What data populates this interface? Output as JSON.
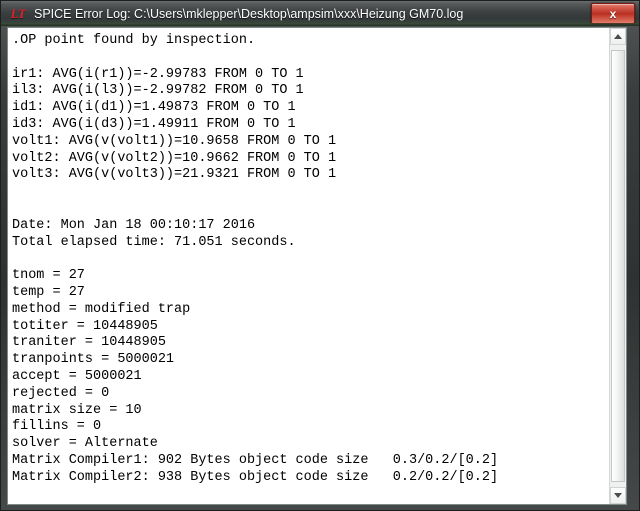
{
  "window": {
    "title": "SPICE Error Log: C:\\Users\\mklepper\\Desktop\\ampsim\\xxx\\Heizung GM70.log",
    "app_icon_label": "LT",
    "close_label": "x",
    "accent_close_color": "#b93124",
    "logo_color": "#d8232a",
    "titlebar_color": "#3d4041"
  },
  "scrollbar": {
    "up_arrow": "scroll-up",
    "down_arrow": "scroll-down",
    "thumb": "scroll-thumb"
  },
  "log": {
    "lines": [
      ".OP point found by inspection.",
      "",
      "ir1: AVG(i(r1))=-2.99783 FROM 0 TO 1",
      "il3: AVG(i(l3))=-2.99782 FROM 0 TO 1",
      "id1: AVG(i(d1))=1.49873 FROM 0 TO 1",
      "id3: AVG(i(d3))=1.49911 FROM 0 TO 1",
      "volt1: AVG(v(volt1))=10.9658 FROM 0 TO 1",
      "volt2: AVG(v(volt2))=10.9662 FROM 0 TO 1",
      "volt3: AVG(v(volt3))=21.9321 FROM 0 TO 1",
      "",
      "",
      "Date: Mon Jan 18 00:10:17 2016",
      "Total elapsed time: 71.051 seconds.",
      "",
      "tnom = 27",
      "temp = 27",
      "method = modified trap",
      "totiter = 10448905",
      "traniter = 10448905",
      "tranpoints = 5000021",
      "accept = 5000021",
      "rejected = 0",
      "matrix size = 10",
      "fillins = 0",
      "solver = Alternate",
      "Matrix Compiler1: 902 Bytes object code size   0.3/0.2/[0.2]",
      "Matrix Compiler2: 938 Bytes object code size   0.2/0.2/[0.2]"
    ]
  }
}
